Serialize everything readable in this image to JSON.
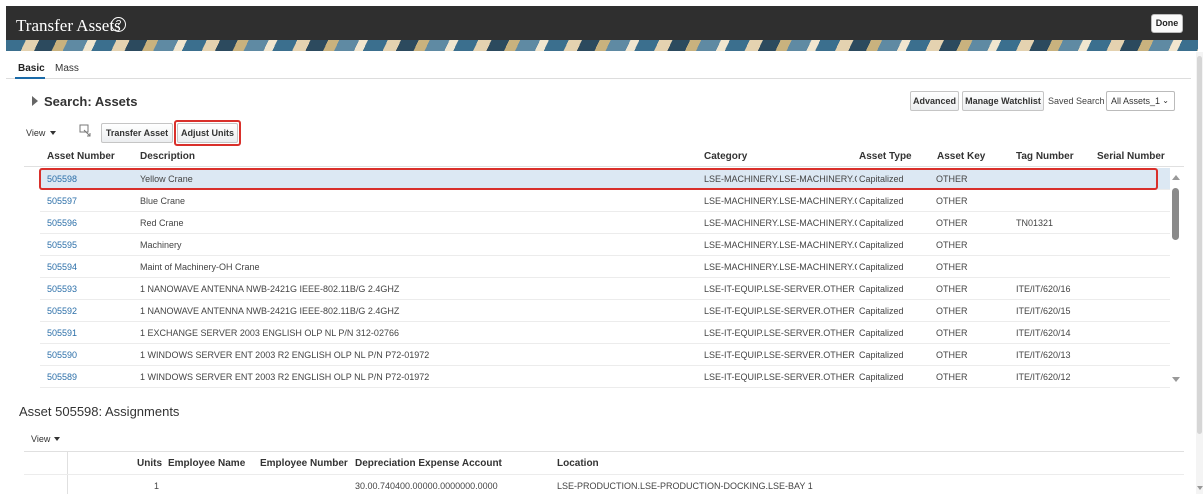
{
  "header": {
    "title": "Transfer Assets",
    "help_icon": "help-circle-icon",
    "done_label": "Done"
  },
  "tabs": [
    {
      "label": "Basic",
      "selected": true
    },
    {
      "label": "Mass",
      "selected": false
    }
  ],
  "search": {
    "title": "Search: Assets",
    "advanced_label": "Advanced",
    "manage_watchlist_label": "Manage Watchlist",
    "saved_search_label": "Saved Search",
    "saved_search_value": "All Assets_1"
  },
  "toolbar": {
    "view_label": "View",
    "detach_icon": "detach-icon",
    "transfer_asset_label": "Transfer Asset",
    "adjust_units_label": "Adjust Units"
  },
  "assets_table": {
    "columns": [
      "Asset Number",
      "Description",
      "Category",
      "Asset Type",
      "Asset Key",
      "Tag Number",
      "Serial Number"
    ],
    "rows": [
      {
        "asset_number": "505598",
        "description": "Yellow Crane",
        "category": "LSE-MACHINERY.LSE-MACHINERY.OTHER",
        "asset_type": "Capitalized",
        "asset_key": "OTHER",
        "tag_number": "",
        "serial_number": "",
        "selected": true
      },
      {
        "asset_number": "505597",
        "description": "Blue Crane",
        "category": "LSE-MACHINERY.LSE-MACHINERY.OTHER",
        "asset_type": "Capitalized",
        "asset_key": "OTHER",
        "tag_number": "",
        "serial_number": ""
      },
      {
        "asset_number": "505596",
        "description": "Red Crane",
        "category": "LSE-MACHINERY.LSE-MACHINERY.OTHER",
        "asset_type": "Capitalized",
        "asset_key": "OTHER",
        "tag_number": "TN01321",
        "serial_number": ""
      },
      {
        "asset_number": "505595",
        "description": "Machinery",
        "category": "LSE-MACHINERY.LSE-MACHINERY.OTHER",
        "asset_type": "Capitalized",
        "asset_key": "OTHER",
        "tag_number": "",
        "serial_number": ""
      },
      {
        "asset_number": "505594",
        "description": "Maint of Machinery-OH Crane",
        "category": "LSE-MACHINERY.LSE-MACHINERY.OTHER",
        "asset_type": "Capitalized",
        "asset_key": "OTHER",
        "tag_number": "",
        "serial_number": ""
      },
      {
        "asset_number": "505593",
        "description": "1 NANOWAVE ANTENNA NWB-2421G IEEE-802.11B/G 2.4GHZ",
        "category": "LSE-IT-EQUIP.LSE-SERVER.OTHER",
        "asset_type": "Capitalized",
        "asset_key": "OTHER",
        "tag_number": "ITE/IT/620/16",
        "serial_number": ""
      },
      {
        "asset_number": "505592",
        "description": "1 NANOWAVE ANTENNA NWB-2421G IEEE-802.11B/G 2.4GHZ",
        "category": "LSE-IT-EQUIP.LSE-SERVER.OTHER",
        "asset_type": "Capitalized",
        "asset_key": "OTHER",
        "tag_number": "ITE/IT/620/15",
        "serial_number": ""
      },
      {
        "asset_number": "505591",
        "description": "1 EXCHANGE SERVER 2003 ENGLISH OLP NL P/N 312-02766",
        "category": "LSE-IT-EQUIP.LSE-SERVER.OTHER",
        "asset_type": "Capitalized",
        "asset_key": "OTHER",
        "tag_number": "ITE/IT/620/14",
        "serial_number": ""
      },
      {
        "asset_number": "505590",
        "description": "1 WINDOWS SERVER ENT 2003 R2 ENGLISH OLP NL P/N P72-01972",
        "category": "LSE-IT-EQUIP.LSE-SERVER.OTHER",
        "asset_type": "Capitalized",
        "asset_key": "OTHER",
        "tag_number": "ITE/IT/620/13",
        "serial_number": ""
      },
      {
        "asset_number": "505589",
        "description": "1 WINDOWS SERVER ENT 2003 R2 ENGLISH OLP NL P/N P72-01972",
        "category": "LSE-IT-EQUIP.LSE-SERVER.OTHER",
        "asset_type": "Capitalized",
        "asset_key": "OTHER",
        "tag_number": "ITE/IT/620/12",
        "serial_number": ""
      }
    ]
  },
  "assignments": {
    "title": "Asset 505598: Assignments",
    "view_label": "View",
    "columns": [
      "Units",
      "Employee Name",
      "Employee Number",
      "Depreciation Expense Account",
      "Location"
    ],
    "rows": [
      {
        "units": "1",
        "employee_name": "",
        "employee_number": "",
        "depreciation_expense_account": "30.00.740400.00000.0000000.0000",
        "location": "LSE-PRODUCTION.LSE-PRODUCTION-DOCKING.LSE-BAY 1"
      }
    ]
  },
  "colors": {
    "header_bg": "#2f2f2f",
    "link": "#2a6ea8",
    "selected_row": "#dce8f3",
    "highlight": "#d9302b"
  }
}
